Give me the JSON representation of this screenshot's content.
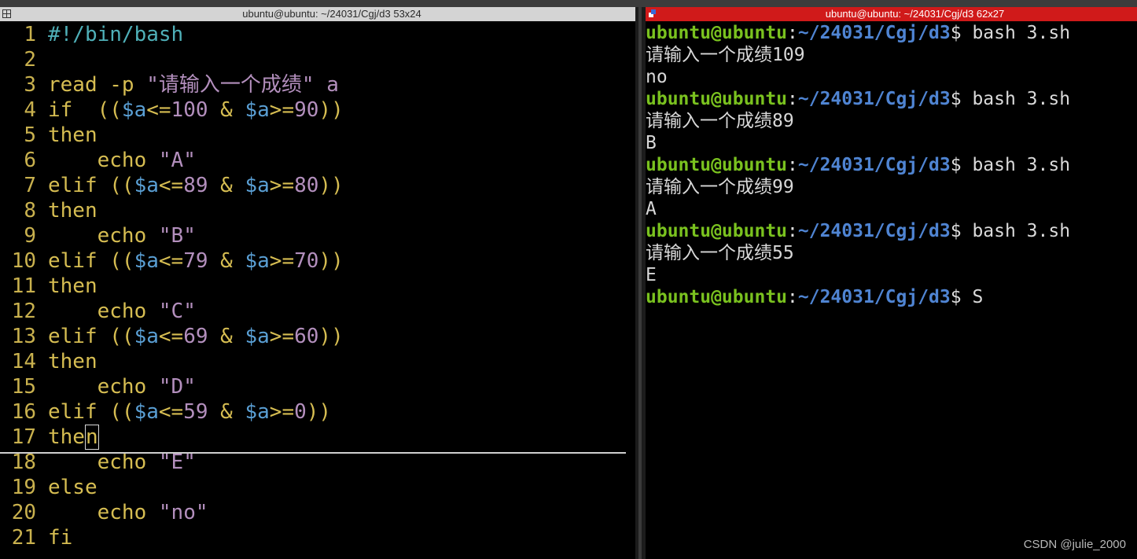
{
  "left_pane": {
    "title": "ubuntu@ubuntu: ~/24031/Cgj/d3 53x24",
    "lines": [
      {
        "n": "1",
        "tokens": [
          {
            "t": "#!/bin/bash",
            "c": "t-shebang"
          }
        ]
      },
      {
        "n": "2",
        "tokens": []
      },
      {
        "n": "3",
        "tokens": [
          {
            "t": "read -p ",
            "c": "t-plain"
          },
          {
            "t": "\"请输入一个成绩\"",
            "c": "t-str"
          },
          {
            "t": " a",
            "c": "t-ident"
          }
        ]
      },
      {
        "n": "4",
        "tokens": [
          {
            "t": "if  ((",
            "c": "t-kw"
          },
          {
            "t": "$a",
            "c": "t-var"
          },
          {
            "t": "<=",
            "c": "t-op"
          },
          {
            "t": "100",
            "c": "t-num"
          },
          {
            "t": " & ",
            "c": "t-op"
          },
          {
            "t": "$a",
            "c": "t-var"
          },
          {
            "t": ">=",
            "c": "t-op"
          },
          {
            "t": "90",
            "c": "t-num"
          },
          {
            "t": "))",
            "c": "t-kw"
          }
        ]
      },
      {
        "n": "5",
        "tokens": [
          {
            "t": "then",
            "c": "t-kw"
          }
        ]
      },
      {
        "n": "6",
        "tokens": [
          {
            "t": "    echo ",
            "c": "t-kw"
          },
          {
            "t": "\"A\"",
            "c": "t-str"
          }
        ]
      },
      {
        "n": "7",
        "tokens": [
          {
            "t": "elif ((",
            "c": "t-kw"
          },
          {
            "t": "$a",
            "c": "t-var"
          },
          {
            "t": "<=",
            "c": "t-op"
          },
          {
            "t": "89",
            "c": "t-num"
          },
          {
            "t": " & ",
            "c": "t-op"
          },
          {
            "t": "$a",
            "c": "t-var"
          },
          {
            "t": ">=",
            "c": "t-op"
          },
          {
            "t": "80",
            "c": "t-num"
          },
          {
            "t": "))",
            "c": "t-kw"
          }
        ]
      },
      {
        "n": "8",
        "tokens": [
          {
            "t": "then",
            "c": "t-kw"
          }
        ]
      },
      {
        "n": "9",
        "tokens": [
          {
            "t": "    echo ",
            "c": "t-kw"
          },
          {
            "t": "\"B\"",
            "c": "t-str"
          }
        ]
      },
      {
        "n": "10",
        "tokens": [
          {
            "t": "elif ((",
            "c": "t-kw"
          },
          {
            "t": "$a",
            "c": "t-var"
          },
          {
            "t": "<=",
            "c": "t-op"
          },
          {
            "t": "79",
            "c": "t-num"
          },
          {
            "t": " & ",
            "c": "t-op"
          },
          {
            "t": "$a",
            "c": "t-var"
          },
          {
            "t": ">=",
            "c": "t-op"
          },
          {
            "t": "70",
            "c": "t-num"
          },
          {
            "t": "))",
            "c": "t-kw"
          }
        ]
      },
      {
        "n": "11",
        "tokens": [
          {
            "t": "then",
            "c": "t-kw"
          }
        ]
      },
      {
        "n": "12",
        "tokens": [
          {
            "t": "    echo ",
            "c": "t-kw"
          },
          {
            "t": "\"C\"",
            "c": "t-str"
          }
        ]
      },
      {
        "n": "13",
        "tokens": [
          {
            "t": "elif ((",
            "c": "t-kw"
          },
          {
            "t": "$a",
            "c": "t-var"
          },
          {
            "t": "<=",
            "c": "t-op"
          },
          {
            "t": "69",
            "c": "t-num"
          },
          {
            "t": " & ",
            "c": "t-op"
          },
          {
            "t": "$a",
            "c": "t-var"
          },
          {
            "t": ">=",
            "c": "t-op"
          },
          {
            "t": "60",
            "c": "t-num"
          },
          {
            "t": "))",
            "c": "t-kw"
          }
        ]
      },
      {
        "n": "14",
        "tokens": [
          {
            "t": "then",
            "c": "t-kw"
          }
        ]
      },
      {
        "n": "15",
        "tokens": [
          {
            "t": "    echo ",
            "c": "t-kw"
          },
          {
            "t": "\"D\"",
            "c": "t-str"
          }
        ]
      },
      {
        "n": "16",
        "tokens": [
          {
            "t": "elif ((",
            "c": "t-kw"
          },
          {
            "t": "$a",
            "c": "t-var"
          },
          {
            "t": "<=",
            "c": "t-op"
          },
          {
            "t": "59",
            "c": "t-num"
          },
          {
            "t": " & ",
            "c": "t-op"
          },
          {
            "t": "$a",
            "c": "t-var"
          },
          {
            "t": ">=",
            "c": "t-op"
          },
          {
            "t": "0",
            "c": "t-num"
          },
          {
            "t": "))",
            "c": "t-kw"
          }
        ]
      },
      {
        "n": "17",
        "tokens": [
          {
            "t": "the",
            "c": "t-kw"
          },
          {
            "t": "n",
            "c": "t-kw cursor-box"
          }
        ]
      },
      {
        "n": "18",
        "tokens": [
          {
            "t": "    echo ",
            "c": "t-kw"
          },
          {
            "t": "\"E\"",
            "c": "t-str"
          }
        ]
      },
      {
        "n": "19",
        "tokens": [
          {
            "t": "else",
            "c": "t-kw"
          }
        ]
      },
      {
        "n": "20",
        "tokens": [
          {
            "t": "    echo ",
            "c": "t-kw"
          },
          {
            "t": "\"no\"",
            "c": "t-str"
          }
        ]
      },
      {
        "n": "21",
        "tokens": [
          {
            "t": "fi",
            "c": "t-kw"
          }
        ]
      }
    ]
  },
  "right_pane": {
    "title": "ubuntu@ubuntu: ~/24031/Cgj/d3 62x27",
    "lines": [
      {
        "kind": "prompt",
        "user": "ubuntu@ubuntu",
        "path": "~/24031/Cgj/d3",
        "cmd": "$ bash 3.sh"
      },
      {
        "kind": "out",
        "text": "请输入一个成绩109"
      },
      {
        "kind": "out",
        "text": "no"
      },
      {
        "kind": "prompt",
        "user": "ubuntu@ubuntu",
        "path": "~/24031/Cgj/d3",
        "cmd": "$ bash 3.sh"
      },
      {
        "kind": "out",
        "text": "请输入一个成绩89"
      },
      {
        "kind": "out",
        "text": "B"
      },
      {
        "kind": "prompt",
        "user": "ubuntu@ubuntu",
        "path": "~/24031/Cgj/d3",
        "cmd": "$ bash 3.sh"
      },
      {
        "kind": "out",
        "text": "请输入一个成绩99"
      },
      {
        "kind": "out",
        "text": "A"
      },
      {
        "kind": "prompt",
        "user": "ubuntu@ubuntu",
        "path": "~/24031/Cgj/d3",
        "cmd": "$ bash 3.sh"
      },
      {
        "kind": "out",
        "text": "请输入一个成绩55"
      },
      {
        "kind": "out",
        "text": "E"
      },
      {
        "kind": "prompt",
        "user": "ubuntu@ubuntu",
        "path": "~/24031/Cgj/d3",
        "cmd": "$ S"
      }
    ]
  },
  "watermark": "CSDN @julie_2000",
  "colors": {
    "background": "#000000",
    "keyword": "#d6bd52",
    "string": "#b38fbd",
    "variable": "#5a9fd4",
    "shebang": "#4fb0b8",
    "prompt_user": "#7ac21f",
    "prompt_path": "#4f84d2",
    "active_titlebar": "#d01a1a",
    "inactive_titlebar": "#d4d4d4"
  },
  "icons": {
    "left_titlebar": "split-pane-icon",
    "right_titlebar": "terminal-window-icon"
  }
}
